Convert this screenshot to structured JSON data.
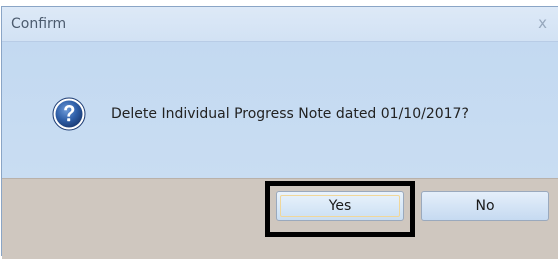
{
  "dialog": {
    "title": "Confirm",
    "close_glyph": "x",
    "icon": "question-icon",
    "message": "Delete Individual Progress Note dated 01/10/2017?",
    "buttons": {
      "yes_label": "Yes",
      "no_label": "No"
    }
  },
  "colors": {
    "body_bg": "#c9dcf2",
    "footer_bg": "#cfc7bf",
    "icon_blue": "#2f5fa8",
    "highlight": "#000000"
  }
}
